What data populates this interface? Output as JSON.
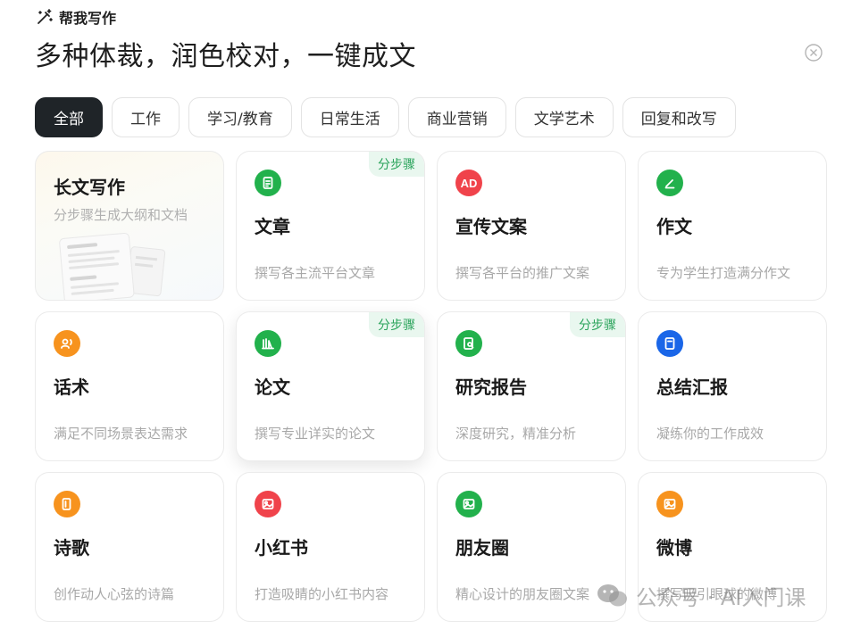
{
  "header": {
    "label": "帮我写作",
    "icon": "magic-wand-icon",
    "subtitle": "多种体裁，润色校对，一键成文"
  },
  "tabs": [
    {
      "label": "全部",
      "active": true
    },
    {
      "label": "工作",
      "active": false
    },
    {
      "label": "学习/教育",
      "active": false
    },
    {
      "label": "日常生活",
      "active": false
    },
    {
      "label": "商业营销",
      "active": false
    },
    {
      "label": "文学艺术",
      "active": false
    },
    {
      "label": "回复和改写",
      "active": false
    }
  ],
  "cards": [
    {
      "title": "长文写作",
      "desc": "分步骤生成大纲和文档",
      "featured": true
    },
    {
      "title": "文章",
      "desc": "撰写各主流平台文章",
      "badge": "分步骤",
      "icon": "article-icon",
      "icon_color": "#22b14c"
    },
    {
      "title": "宣传文案",
      "desc": "撰写各平台的推广文案",
      "icon": "ad-icon",
      "icon_color": "#f0434b",
      "icon_text": "AD"
    },
    {
      "title": "作文",
      "desc": "专为学生打造满分作文",
      "icon": "pen-icon",
      "icon_color": "#22b14c"
    },
    {
      "title": "话术",
      "desc": "满足不同场景表达需求",
      "icon": "speaker-icon",
      "icon_color": "#f7931e"
    },
    {
      "title": "论文",
      "desc": "撰写专业详实的论文",
      "badge": "分步骤",
      "icon": "books-icon",
      "icon_color": "#22b14c",
      "hover": true
    },
    {
      "title": "研究报告",
      "desc": "深度研究，精准分析",
      "badge": "分步骤",
      "icon": "report-search-icon",
      "icon_color": "#22b14c"
    },
    {
      "title": "总结汇报",
      "desc": "凝练你的工作成效",
      "icon": "summary-icon",
      "icon_color": "#1a66e8"
    },
    {
      "title": "诗歌",
      "desc": "创作动人心弦的诗篇",
      "icon": "poem-icon",
      "icon_color": "#f7931e"
    },
    {
      "title": "小红书",
      "desc": "打造吸睛的小红书内容",
      "icon": "image-post-icon",
      "icon_color": "#f0434b"
    },
    {
      "title": "朋友圈",
      "desc": "精心设计的朋友圈文案",
      "icon": "image-post-icon",
      "icon_color": "#22b14c"
    },
    {
      "title": "微博",
      "desc": "撰写吸引眼球的微博",
      "icon": "image-post-icon",
      "icon_color": "#f7931e"
    }
  ],
  "watermark": {
    "text": "公众号 · AI入门课"
  }
}
